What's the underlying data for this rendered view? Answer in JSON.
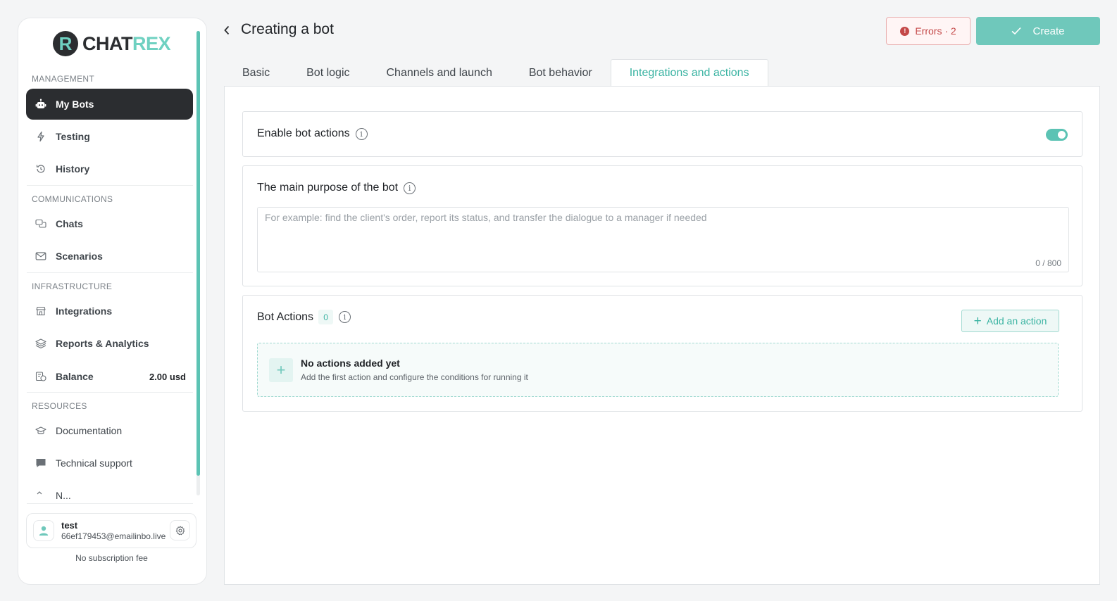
{
  "brand": {
    "mark": "R",
    "name_a": "CHAT",
    "name_b": "REX"
  },
  "sidebar": {
    "sections": {
      "management": "MANAGEMENT",
      "communications": "COMMUNICATIONS",
      "infrastructure": "INFRASTRUCTURE",
      "resources": "RESOURCES"
    },
    "items": {
      "my_bots": "My Bots",
      "testing": "Testing",
      "history": "History",
      "chats": "Chats",
      "scenarios": "Scenarios",
      "integrations": "Integrations",
      "reports": "Reports & Analytics",
      "balance": "Balance",
      "balance_value": "2.00 usd",
      "documentation": "Documentation",
      "support": "Technical support",
      "news": "N..."
    },
    "user": {
      "name": "test",
      "email": "66ef179453@emailinbo.live"
    },
    "subscription": "No subscription fee"
  },
  "header": {
    "title": "Creating a bot",
    "errors_label": "Errors · 2",
    "create_label": "Create"
  },
  "tabs": {
    "basic": "Basic",
    "logic": "Bot logic",
    "channels": "Channels and launch",
    "behavior": "Bot behavior",
    "integrations": "Integrations and actions"
  },
  "enable_card": {
    "title": "Enable bot actions",
    "enabled": true
  },
  "purpose_card": {
    "title": "The main purpose of the bot",
    "placeholder": "For example: find the client's order, report its status, and transfer the dialogue to a manager if needed",
    "counter": "0 / 800"
  },
  "actions_card": {
    "title": "Bot Actions",
    "count": "0",
    "add_label": "Add an action",
    "empty_title": "No actions added yet",
    "empty_sub": "Add the first action and configure the conditions for running it"
  },
  "colors": {
    "accent": "#5cc3b4",
    "dark": "#2b2d30",
    "error": "#c44848"
  }
}
